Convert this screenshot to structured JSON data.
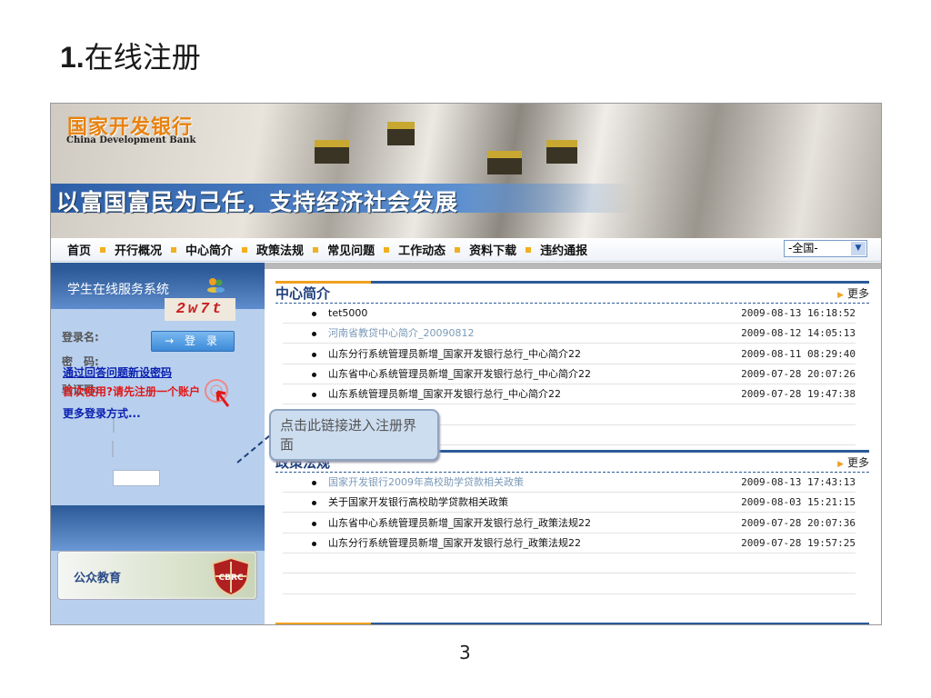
{
  "slide": {
    "title_num": "1.",
    "title_text": "在线注册",
    "page_number": "3",
    "callout": "点击此链接进入注册界面"
  },
  "banner": {
    "logo_cn": "国家开发银行",
    "logo_en": "China Development Bank",
    "slogan": "以富国富民为己任，支持经济社会发展"
  },
  "nav": {
    "items": [
      "首页",
      "开行概况",
      "中心简介",
      "政策法规",
      "常见问题",
      "工作动态",
      "资料下载",
      "违约通报"
    ],
    "region_select": "-全国-"
  },
  "sidebar": {
    "title": "学生在线服务系统",
    "login_label": "登录名:",
    "password_label": "密　码:",
    "captcha_label": "验证码:",
    "captcha_text": "2w7t",
    "login_button": "→ 登 录",
    "reset_link": "通过回答问题新设密码",
    "register_link": "首次使用?请先注册一个账户",
    "more_login": "更多登录方式...",
    "public_edu": "公众教育",
    "edu_badge": "CBRC"
  },
  "sections": [
    {
      "title": "中心简介",
      "more": "更多",
      "rows": [
        {
          "title": "tet5000",
          "date": "2009-08-13 16:18:52",
          "visited": false
        },
        {
          "title": "河南省教贷中心简介_20090812",
          "date": "2009-08-12 14:05:13",
          "visited": true
        },
        {
          "title": "山东分行系统管理员新增_国家开发银行总行_中心简介22",
          "date": "2009-08-11 08:29:40",
          "visited": false
        },
        {
          "title": "山东省中心系统管理员新增_国家开发银行总行_中心简介22",
          "date": "2009-07-28 20:07:26",
          "visited": false
        },
        {
          "title": "山东系统管理员新增_国家开发银行总行_中心简介22",
          "date": "2009-07-28 19:47:38",
          "visited": false
        }
      ]
    },
    {
      "title": "政策法规",
      "more": "更多",
      "rows": [
        {
          "title": "国家开发银行2009年高校助学贷款相关政策",
          "date": "2009-08-13 17:43:13",
          "visited": true
        },
        {
          "title": "关于国家开发银行高校助学贷款相关政策",
          "date": "2009-08-03 15:21:15",
          "visited": false
        },
        {
          "title": "山东省中心系统管理员新增_国家开发银行总行_政策法规22",
          "date": "2009-07-28 20:07:36",
          "visited": false
        },
        {
          "title": "山东分行系统管理员新增_国家开发银行总行_政策法规22",
          "date": "2009-07-28 19:57:25",
          "visited": false
        }
      ]
    }
  ],
  "colors": {
    "brand_blue": "#2c5a98",
    "accent_orange": "#f0a020",
    "register_red": "#e01818",
    "link_blue": "#0a1fb0"
  }
}
